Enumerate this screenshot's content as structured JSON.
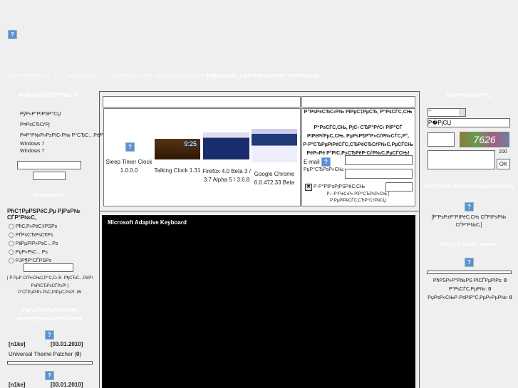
{
  "nav": [
    "РўР»Р°РІРЅР°СЏ",
    "Р¤РѕСЂСѓРј",
    "РќРѕРІРѕРµ РЅР° СЃРѕС„С‚РїРѕСЂС‚Р°Р»Рµ",
    "Р РµРіРёСЃС‚СЂР°С†РёСЏ РЅР° СЃР°Р№С‚Рµ"
  ],
  "left": {
    "menu_title": "РњРµРЅСЋ СЃР°Р№С‚Р°",
    "menu": [
      "РўР»Р°РІРЅР°СЏ",
      "Р¤РѕСЂСѓРј",
      "Р¤Р°Р№Р»РѕРІС‹Р№ Р°СЂС…РёРІ",
      "Windows 7",
      "Windows 7"
    ],
    "poll_header": "РћРїСЂРѕСЃ",
    "poll_question": "РћС†РµРЅРёС‚Рµ РјРѕР№ СЃР°Р№С‚",
    "poll_options": [
      "РћС‚Р»РёС‡РЅРѕ",
      "РҐРѕСЂРѕС€Рѕ",
      "РќРµРїР»РѕС…Рѕ",
      "РџР»РѕС…Рѕ",
      "РЈР¶Р°СЃРЅРѕ"
    ],
    "poll_results": "[ Р РµР·СѓР»СЊС‚Р°С‚С‹ В· РђСЂС…РёРІ РѕРїСЂРѕСЃРѕРІ ]",
    "poll_total": "Р’СЃРµРіРѕ РѕС‚РІРµС‚РѕРІ: 85",
    "comments_header": "РџРѕСЃР»РµРґРЅРёРµ РєРѕРјРјРµРЅС‚Р°СЂРёРё",
    "entries": [
      {
        "user": "[n1ke]",
        "date": "[03.01.2010]",
        "title": "Universal Theme Patcher",
        "count": "0"
      },
      {
        "user": "[n1ke]",
        "date": "[03.01.2010]"
      }
    ]
  },
  "products": [
    {
      "name": "Sleep Timer Clock 1.0.0.0"
    },
    {
      "name": "Talking Clock 1.31"
    },
    {
      "name": "Firefox 4.0 Beta 3 / 3.7 Alpha 5 / 3.6.8"
    },
    {
      "name": "Google Chrome 6.0.472.33 Beta"
    }
  ],
  "form": {
    "title": "Р”РѕР±СЂС‹Р№ РІРµС‡РµСЂ, Р“РѕСЃС‚СЊ",
    "text": "Р“РѕСЃС‚СЊ, РјС‹ СЂР°РґС‹ РІР°СЃ РІРёРґРµС‚СЊ. РџРѕР¶Р°Р»СѓР№СЃС‚Р°, Р·Р°СЂРµРіРёСЃС‚СЂРёСЂСѓР№С‚РµСЃСЊ РёР»Рё Р°РІС‚РѕСЂРёР·СѓР№С‚РµСЃСЊ!",
    "email_label": "E-mail",
    "password_label": "РџР°СЂРѕР»СЊ:",
    "remember_label": "Р·Р°РїРѕРјРЅРёС‚СЊ",
    "forgot": "Р—Р°Р±С‹Р» РїР°СЂРѕР»СЊ |",
    "register": "Р РµРіРёСЃС‚СЂР°С†РёСЏ"
  },
  "video": {
    "title": "Microsoft Adaptive Keyboard"
  },
  "right": {
    "chat_header": "РњРёРЅРё-С‡Р°С‚",
    "select_value": "--",
    "name_value": "Р�РјСЏ",
    "captcha": "7626",
    "counter": "200",
    "ok": "OK",
    "sponsor_header": "РЎР°РјС‹Рµ РїРѕРїСѓР»СЏСЂРЅС‹Рµ",
    "sponsor_text": "[Р”РѕР±Р°РІРёС‚СЊ СЃРІРѕР№ СЃР°Р№С‚]",
    "stats_header": "РЎС‚Р°С‚РёСЃС‚РёРєР°",
    "stats": [
      {
        "label": "РћРЅР»Р°Р№РЅ РІСЃРµРіРѕ:",
        "value": "0"
      },
      {
        "label": "Р“РѕСЃС‚РµР№:",
        "value": "0"
      },
      {
        "label": "РџРѕР»СЊР·РѕРІР°С‚РµР»РµР№:",
        "value": "0"
      }
    ]
  }
}
